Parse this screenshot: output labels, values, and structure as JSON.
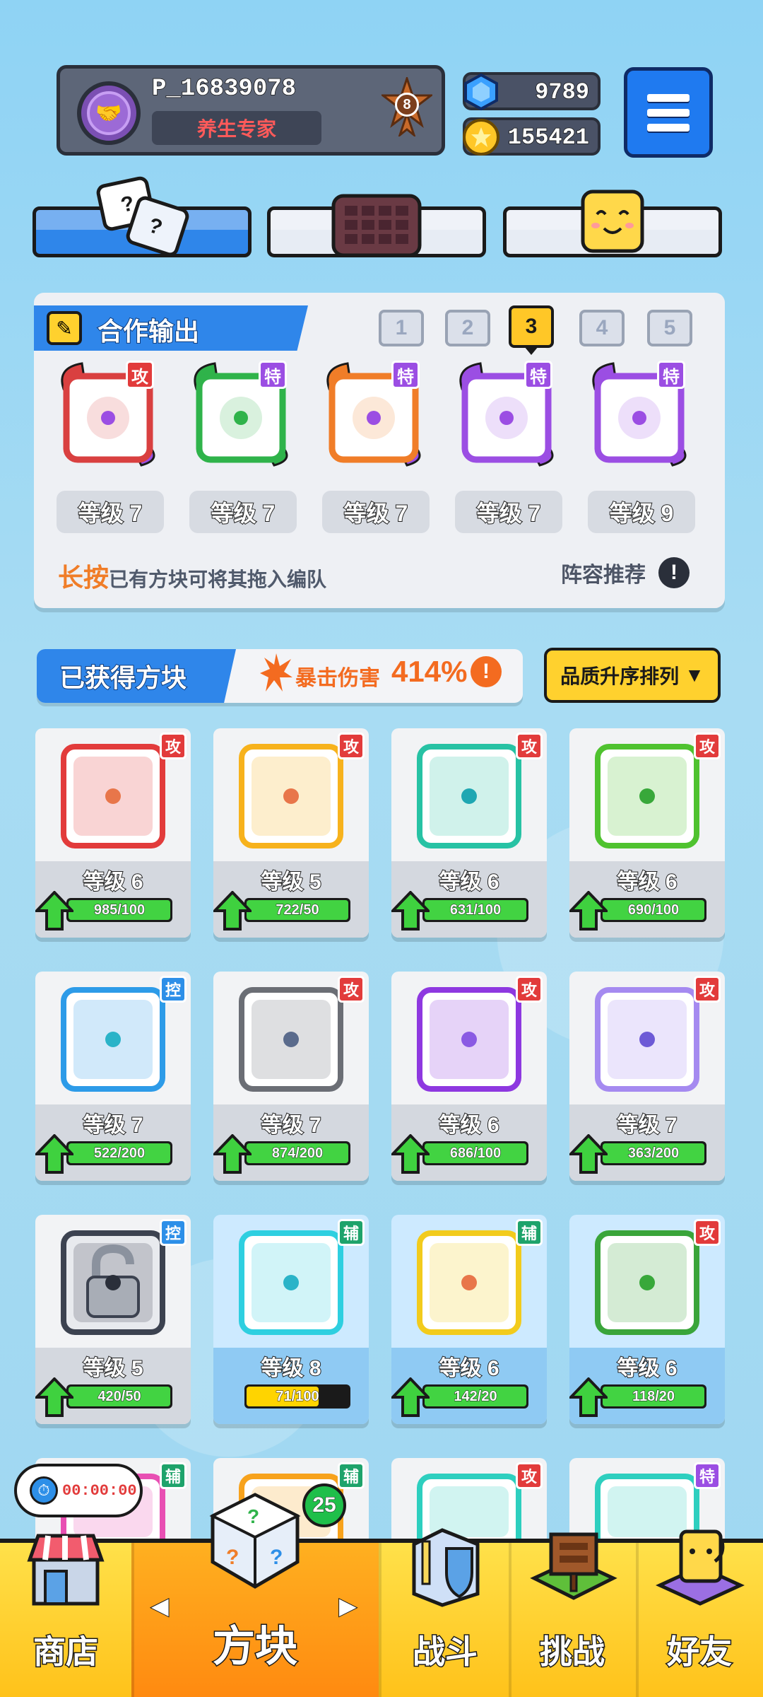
{
  "profile": {
    "name": "P_16839078",
    "title": "养生专家",
    "rank": "8"
  },
  "currency": {
    "gems": "9789",
    "coins": "155421"
  },
  "team": {
    "title": "合作输出",
    "slots": [
      "1",
      "2",
      "3",
      "4",
      "5"
    ],
    "active_slot": "3",
    "members": [
      {
        "tag": "攻",
        "level": "等级 7",
        "color": "#d94040",
        "accent": "#9b4ee3"
      },
      {
        "tag": "特",
        "level": "等级 7",
        "color": "#2fb34a",
        "accent": "#2fb34a"
      },
      {
        "tag": "特",
        "level": "等级 7",
        "color": "#f07d28",
        "accent": "#9b4ee3"
      },
      {
        "tag": "特",
        "level": "等级 7",
        "color": "#9b4ee3",
        "accent": "#9b4ee3"
      },
      {
        "tag": "特",
        "level": "等级 9",
        "color": "#9b4ee3",
        "accent": "#9b4ee3"
      }
    ],
    "hint_highlight": "长按",
    "hint_text": "已有方块可将其拖入编队",
    "lineup_label": "阵容推荐"
  },
  "acquired": {
    "title": "已获得方块",
    "crit_label": "暴击伤害",
    "crit_value": "414%",
    "sort_label": "品质升序排列"
  },
  "blocks": [
    {
      "tag": "攻",
      "tag_type": "atk",
      "level": "等级 6",
      "progress": "985/100",
      "ratio": 1.0,
      "color": "#e23b3b",
      "dot": "#e8764a",
      "bar": "green"
    },
    {
      "tag": "攻",
      "tag_type": "atk",
      "level": "等级 5",
      "progress": "722/50",
      "ratio": 1.0,
      "color": "#f7b21c",
      "dot": "#e8764a",
      "bar": "green"
    },
    {
      "tag": "攻",
      "tag_type": "atk",
      "level": "等级 6",
      "progress": "631/100",
      "ratio": 1.0,
      "color": "#27c2a4",
      "dot": "#1ea7b2",
      "bar": "green"
    },
    {
      "tag": "攻",
      "tag_type": "atk",
      "level": "等级 6",
      "progress": "690/100",
      "ratio": 1.0,
      "color": "#4fc22f",
      "dot": "#38a83a",
      "bar": "green"
    },
    {
      "tag": "控",
      "tag_type": "ctl",
      "level": "等级 7",
      "progress": "522/200",
      "ratio": 1.0,
      "color": "#2d9be8",
      "dot": "#2ab3c8",
      "bar": "green"
    },
    {
      "tag": "攻",
      "tag_type": "atk",
      "level": "等级 7",
      "progress": "874/200",
      "ratio": 1.0,
      "color": "#6b6e75",
      "dot": "#5a6b8c",
      "bar": "green"
    },
    {
      "tag": "攻",
      "tag_type": "atk",
      "level": "等级 6",
      "progress": "686/100",
      "ratio": 1.0,
      "color": "#8e38e0",
      "dot": "#8a5ae3",
      "bar": "green"
    },
    {
      "tag": "攻",
      "tag_type": "atk",
      "level": "等级 7",
      "progress": "363/200",
      "ratio": 1.0,
      "color": "#a58af0",
      "dot": "#6d5ad6",
      "bar": "green"
    },
    {
      "tag": "控",
      "tag_type": "ctl",
      "level": "等级 5",
      "progress": "420/50",
      "ratio": 1.0,
      "color": "#3c4250",
      "dot": "#2a2f3a",
      "bar": "green",
      "locked": true
    },
    {
      "tag": "辅",
      "tag_type": "sup",
      "level": "等级 8",
      "progress": "71/100",
      "ratio": 0.71,
      "color": "#2ecfe0",
      "dot": "#2ab3c8",
      "bar": "yellow",
      "hl": true
    },
    {
      "tag": "辅",
      "tag_type": "sup",
      "level": "等级 6",
      "progress": "142/20",
      "ratio": 1.0,
      "color": "#f2cb1c",
      "dot": "#e8764a",
      "bar": "green",
      "hl": true
    },
    {
      "tag": "攻",
      "tag_type": "atk",
      "level": "等级 6",
      "progress": "118/20",
      "ratio": 1.0,
      "color": "#3aa53a",
      "dot": "#38a83a",
      "bar": "green",
      "hl": true
    }
  ],
  "partial_row": [
    {
      "tag": "辅",
      "tag_type": "sup",
      "color": "#e84fb3"
    },
    {
      "tag": "辅",
      "tag_type": "sup",
      "color": "#f7a21c"
    },
    {
      "tag": "攻",
      "tag_type": "atk",
      "color": "#2ecfbf"
    },
    {
      "tag": "特",
      "tag_type": "spe",
      "color": "#2ecfbf"
    }
  ],
  "timer": "00:00:00",
  "nav": {
    "shop": "商店",
    "blocks": "方块",
    "blocks_badge": "25",
    "battle": "战斗",
    "challenge": "挑战",
    "friends": "好友"
  }
}
